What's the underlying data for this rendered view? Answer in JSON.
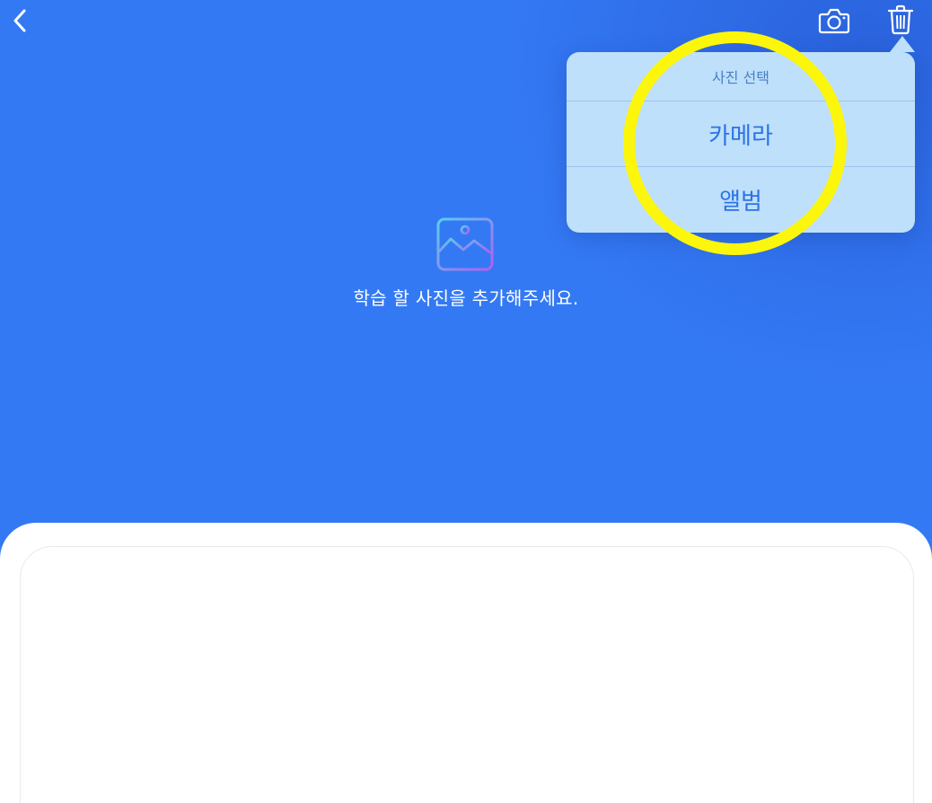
{
  "header": {
    "back_icon": "chevron-left-icon",
    "camera_icon": "camera-icon",
    "trash_icon": "trash-icon"
  },
  "placeholder": {
    "icon": "image-icon",
    "text": "학습 할 사진을 추가해주세요."
  },
  "popover": {
    "title": "사진 선택",
    "items": [
      {
        "label": "카메라"
      },
      {
        "label": "앨범"
      }
    ]
  },
  "colors": {
    "background": "#3479f4",
    "popover_bg": "#bee0fa",
    "popover_text": "#2d72e6",
    "highlight": "#fcf60c"
  }
}
